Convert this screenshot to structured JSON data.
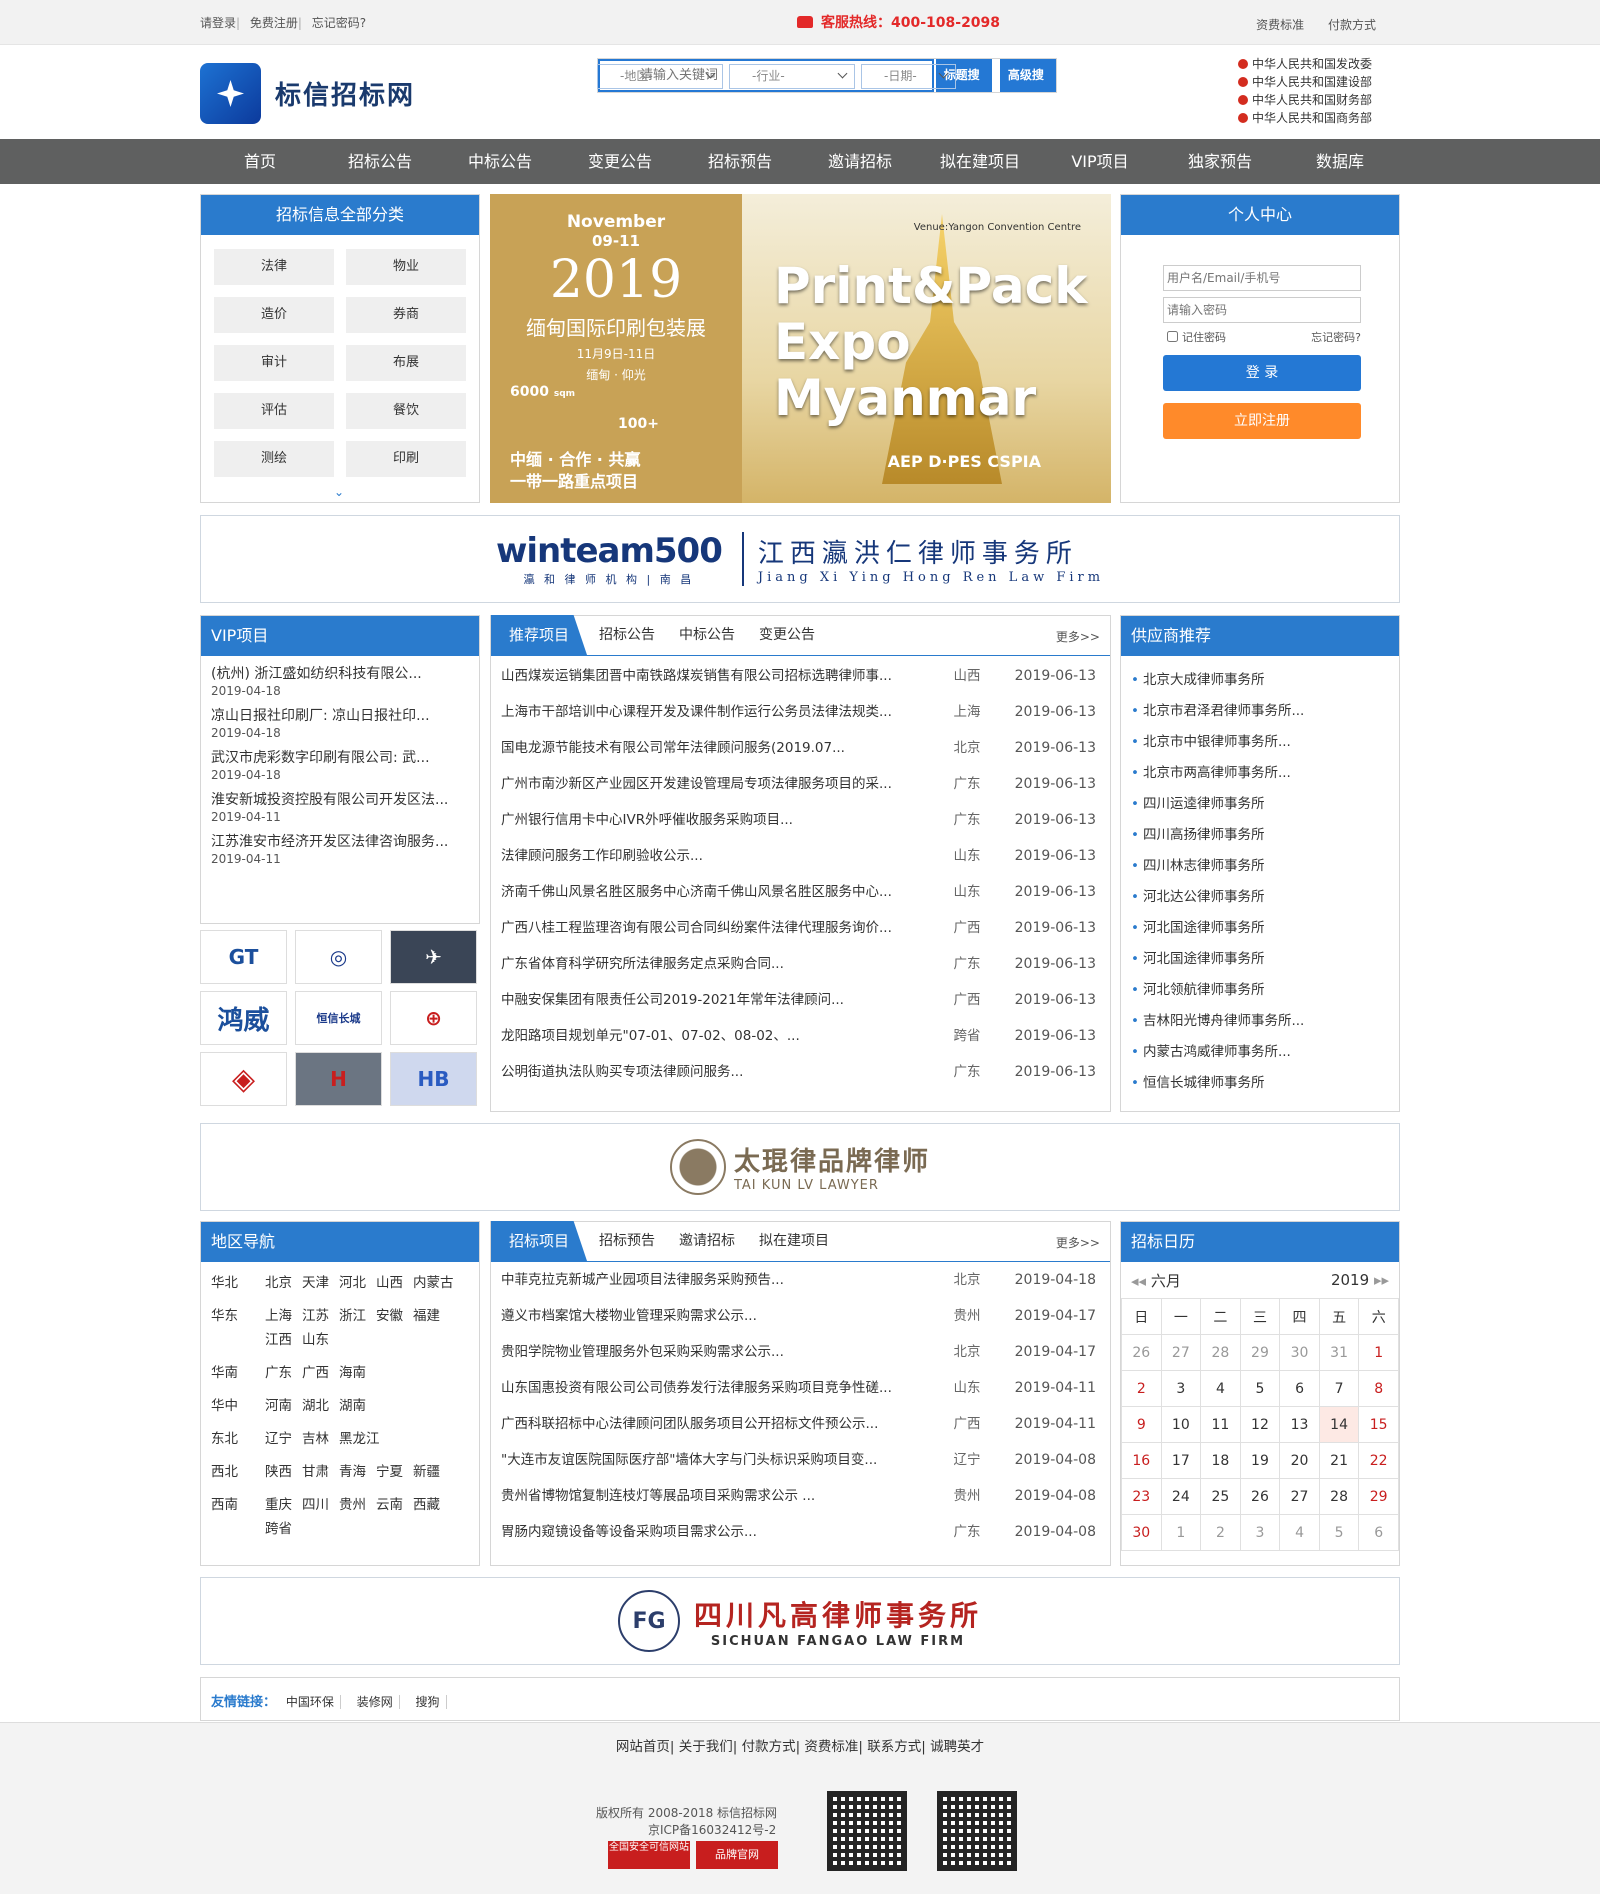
{
  "topbar": {
    "login": "请登录",
    "register": "免费注册",
    "forgot": "忘记密码?",
    "hotline": "客服热线：400-108-2098",
    "links": [
      "资费标准",
      "付款方式"
    ]
  },
  "logo": {
    "name": "标信招标网"
  },
  "search": {
    "placeholder": "请输入关键词",
    "btn_title": "标题搜索",
    "btn_adv": "高级搜索",
    "selects": [
      "-地区-",
      "-行业-",
      "-日期-"
    ]
  },
  "gov": [
    "中华人民共和国发改委",
    "中华人民共和国建设部",
    "中华人民共和国财务部",
    "中华人民共和国商务部"
  ],
  "nav": [
    "首页",
    "招标公告",
    "中标公告",
    "变更公告",
    "招标预告",
    "邀请招标",
    "拟在建项目",
    "VIP项目",
    "独家预告",
    "数据库"
  ],
  "categories": {
    "title": "招标信息全部分类",
    "items": [
      "法律",
      "物业",
      "造价",
      "券商",
      "审计",
      "布展",
      "评估",
      "餐饮",
      "测绘",
      "印刷"
    ]
  },
  "banner": {
    "month": "November",
    "days": "09-11",
    "year": "2019",
    "title": "缅甸国际印刷包装展",
    "date": "11月9日-11日",
    "place": "缅甸 · 仰光",
    "area": "6000",
    "area_unit": "sqm",
    "exhibitors": "100+",
    "slogan1": "中缅 · 合作 · 共赢",
    "slogan2": "一带一路重点项目",
    "headline": "Print&Pack Expo Myanmar",
    "venue": "Venue:Yangon Convention Centre",
    "brand": "AEP D·PES CSPIA"
  },
  "user": {
    "title": "个人中心",
    "user_ph": "用户名/Email/手机号",
    "pwd_ph": "请输入密码",
    "remember": "记住密码",
    "forgot": "忘记密码?",
    "login": "登 录",
    "register": "立即注册"
  },
  "ad1": {
    "brand": "winteam500",
    "sub": "瀛 和 律 师 机 构 | 南 昌",
    "firm": "江西瀛洪仁律师事务所",
    "firm_en": "Jiang Xi Ying Hong Ren Law Firm"
  },
  "vip": {
    "title": "VIP项目",
    "items": [
      {
        "t": "(杭州) 浙江盛如纺织科技有限公...",
        "d": "2019-04-18"
      },
      {
        "t": "凉山日报社印刷厂: 凉山日报社印...",
        "d": "2019-04-18"
      },
      {
        "t": "武汉市虎彩数字印刷有限公司: 武...",
        "d": "2019-04-18"
      },
      {
        "t": "淮安新城投资控股有限公司开发区法...",
        "d": "2019-04-11"
      },
      {
        "t": "江苏淮安市经济开发区法律咨询服务...",
        "d": "2019-04-11"
      }
    ],
    "logos": [
      "GT",
      "◎",
      "✈",
      "鸿威",
      "恒信长城",
      "⊕",
      "◈",
      "H",
      "HB"
    ]
  },
  "recommend": {
    "tab_active": "推荐项目",
    "tabs": [
      "招标公告",
      "中标公告",
      "变更公告"
    ],
    "more": "更多>>",
    "rows": [
      [
        "山西煤炭运销集团晋中南铁路煤炭销售有限公司招标选聘律师事...",
        "山西",
        "2019-06-13"
      ],
      [
        "上海市干部培训中心课程开发及课件制作运行公务员法律法规类...",
        "上海",
        "2019-06-13"
      ],
      [
        "国电龙源节能技术有限公司常年法律顾问服务(2019.07...",
        "北京",
        "2019-06-13"
      ],
      [
        "广州市南沙新区产业园区开发建设管理局专项法律服务项目的采...",
        "广东",
        "2019-06-13"
      ],
      [
        "广州银行信用卡中心IVR外呼催收服务采购项目...",
        "广东",
        "2019-06-13"
      ],
      [
        "法律顾问服务工作印刷验收公示...",
        "山东",
        "2019-06-13"
      ],
      [
        "济南千佛山风景名胜区服务中心济南千佛山风景名胜区服务中心...",
        "山东",
        "2019-06-13"
      ],
      [
        "广西八桂工程监理咨询有限公司合同纠纷案件法律代理服务询价...",
        "广西",
        "2019-06-13"
      ],
      [
        "广东省体育科学研究所法律服务定点采购合同...",
        "广东",
        "2019-06-13"
      ],
      [
        "中融安保集团有限责任公司2019-2021年常年法律顾问...",
        "广西",
        "2019-06-13"
      ],
      [
        "龙阳路项目规划单元\"07-01、07-02、08-02、...",
        "跨省",
        "2019-06-13"
      ],
      [
        "公明街道执法队购买专项法律顾问服务...",
        "广东",
        "2019-06-13"
      ]
    ]
  },
  "supplier": {
    "title": "供应商推荐",
    "items": [
      "北京大成律师事务所",
      "北京市君泽君律师事务所...",
      "北京市中银律师事务所...",
      "北京市两高律师事务所...",
      "四川运逵律师事务所",
      "四川高扬律师事务所",
      "四川林志律师事务所",
      "河北达公律师事务所",
      "河北国途律师事务所",
      "河北国途律师事务所",
      "河北领航律师事务所",
      "吉林阳光博舟律师事务所...",
      "内蒙古鸿威律师事务所...",
      "恒信长城律师事务所"
    ]
  },
  "ad2": {
    "cn": "太琨律品牌律师",
    "en": "TAI KUN LV LAWYER"
  },
  "region": {
    "title": "地区导航",
    "rows": [
      {
        "k": "华北",
        "v": [
          "北京",
          "天津",
          "河北",
          "山西",
          "内蒙古"
        ]
      },
      {
        "k": "华东",
        "v": [
          "上海",
          "江苏",
          "浙江",
          "安徽",
          "福建",
          "江西",
          "山东"
        ]
      },
      {
        "k": "华南",
        "v": [
          "广东",
          "广西",
          "海南"
        ]
      },
      {
        "k": "华中",
        "v": [
          "河南",
          "湖北",
          "湖南"
        ]
      },
      {
        "k": "东北",
        "v": [
          "辽宁",
          "吉林",
          "黑龙江"
        ]
      },
      {
        "k": "西北",
        "v": [
          "陕西",
          "甘肃",
          "青海",
          "宁夏",
          "新疆"
        ]
      },
      {
        "k": "西南",
        "v": [
          "重庆",
          "四川",
          "贵州",
          "云南",
          "西藏",
          "跨省"
        ]
      }
    ]
  },
  "bids": {
    "tab_active": "招标项目",
    "tabs": [
      "招标预告",
      "邀请招标",
      "拟在建项目"
    ],
    "more": "更多>>",
    "rows": [
      [
        "中菲克拉克新城产业园项目法律服务采购预告...",
        "北京",
        "2019-04-18"
      ],
      [
        "遵义市档案馆大楼物业管理采购需求公示...",
        "贵州",
        "2019-04-17"
      ],
      [
        "贵阳学院物业管理服务外包采购采购需求公示...",
        "北京",
        "2019-04-17"
      ],
      [
        "山东国惠投资有限公司公司债券发行法律服务采购项目竞争性磋...",
        "山东",
        "2019-04-11"
      ],
      [
        "广西科联招标中心法律顾问团队服务项目公开招标文件预公示...",
        "广西",
        "2019-04-11"
      ],
      [
        "\"大连市友谊医院国际医疗部\"墙体大字与门头标识采购项目变...",
        "辽宁",
        "2019-04-08"
      ],
      [
        "贵州省博物馆复制连枝灯等展品项目采购需求公示 ...",
        "贵州",
        "2019-04-08"
      ],
      [
        "胃肠内窥镜设备等设备采购项目需求公示...",
        "广东",
        "2019-04-08"
      ]
    ]
  },
  "calendar": {
    "title": "招标日历",
    "month": "六月",
    "year": "2019",
    "weekdays": [
      "日",
      "一",
      "二",
      "三",
      "四",
      "五",
      "六"
    ],
    "weeks": [
      [
        "26",
        "27",
        "28",
        "29",
        "30",
        "31",
        "1"
      ],
      [
        "2",
        "3",
        "4",
        "5",
        "6",
        "7",
        "8"
      ],
      [
        "9",
        "10",
        "11",
        "12",
        "13",
        "14",
        "15"
      ],
      [
        "16",
        "17",
        "18",
        "19",
        "20",
        "21",
        "22"
      ],
      [
        "23",
        "24",
        "25",
        "26",
        "27",
        "28",
        "29"
      ],
      [
        "30",
        "1",
        "2",
        "3",
        "4",
        "5",
        "6"
      ]
    ]
  },
  "ad3": {
    "cn": "四川凡高律师事务所",
    "en": "SICHUAN FANGAO LAW FIRM"
  },
  "friend": {
    "label": "友情链接：",
    "items": [
      "中国环保",
      "装修网",
      "搜狗"
    ]
  },
  "footer": {
    "links": [
      "网站首页",
      "关于我们",
      "付款方式",
      "资费标准",
      "联系方式",
      "诚聘英才"
    ],
    "copy": "版权所有 2008-2018 标信招标网",
    "icp": "京ICP备16032412号-2",
    "badge1": "全国安全可信网站",
    "badge2": "品牌官网"
  },
  "colors": {
    "blue": "#2a7bcd",
    "nav": "#5f6060",
    "orange": "#ff8a2a",
    "red": "#e32929"
  }
}
